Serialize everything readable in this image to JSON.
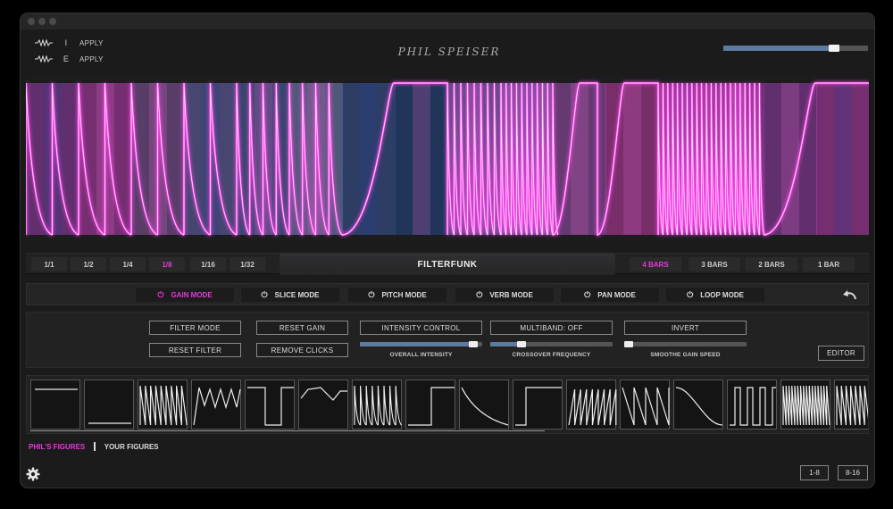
{
  "header": {
    "brand": "PHIL SPEISER",
    "modifiers": [
      {
        "letter": "I",
        "label": "APPLY"
      },
      {
        "letter": "E",
        "label": "APPLY"
      }
    ],
    "top_slider_value": 0.78
  },
  "divisions": [
    "1/1",
    "1/2",
    "1/4",
    "1/8",
    "1/16",
    "1/32"
  ],
  "active_division": "1/8",
  "preset_name": "FILTERFUNK",
  "bar_lengths": [
    "4 BARS",
    "3 BARS",
    "2 BARS",
    "1 BAR"
  ],
  "active_bar_length": "4 BARS",
  "modes": [
    "GAIN MODE",
    "SLICE MODE",
    "PITCH MODE",
    "VERB MODE",
    "PAN MODE",
    "LOOP MODE"
  ],
  "active_mode": "GAIN MODE",
  "controls": {
    "filter_mode": "FILTER MODE",
    "reset_filter": "RESET FILTER",
    "reset_gain": "RESET GAIN",
    "remove_clicks": "REMOVE CLICKS",
    "intensity_control": "INTENSITY CONTROL",
    "multiband": "MULTIBAND: OFF",
    "invert": "INVERT",
    "editor": "EDITOR",
    "overall_intensity_label": "OVERALL INTENSITY",
    "crossover_frequency_label": "CROSSOVER FREQUENCY",
    "smoothe_gain_speed_label": "SMOOTHE GAIN SPEED",
    "overall_intensity_value": 0.95,
    "crossover_frequency_value": 0.28,
    "smoothe_gain_speed_value": 0.05
  },
  "figures": [
    "flat-high",
    "flat-low",
    "saw-dense",
    "zigzag",
    "square-dip",
    "hump",
    "saw-decay",
    "square-pulse",
    "ramp-down",
    "step-up",
    "saw-up",
    "saw-down",
    "s-curve",
    "pulse-train",
    "saw-ultra",
    "saw-fine"
  ],
  "figure_tabs": [
    "PHIL'S FIGURES",
    "YOUR FIGURES"
  ],
  "active_figure_tab": "PHIL'S FIGURES",
  "pages": [
    "1-8",
    "8-16"
  ],
  "colors": {
    "accent": "#e43ad8",
    "slider_fill": "#5d7aa0",
    "background": "#1b1b1c"
  },
  "icons": [
    "waveform-icon",
    "power-icon",
    "undo-icon",
    "gear-icon"
  ]
}
